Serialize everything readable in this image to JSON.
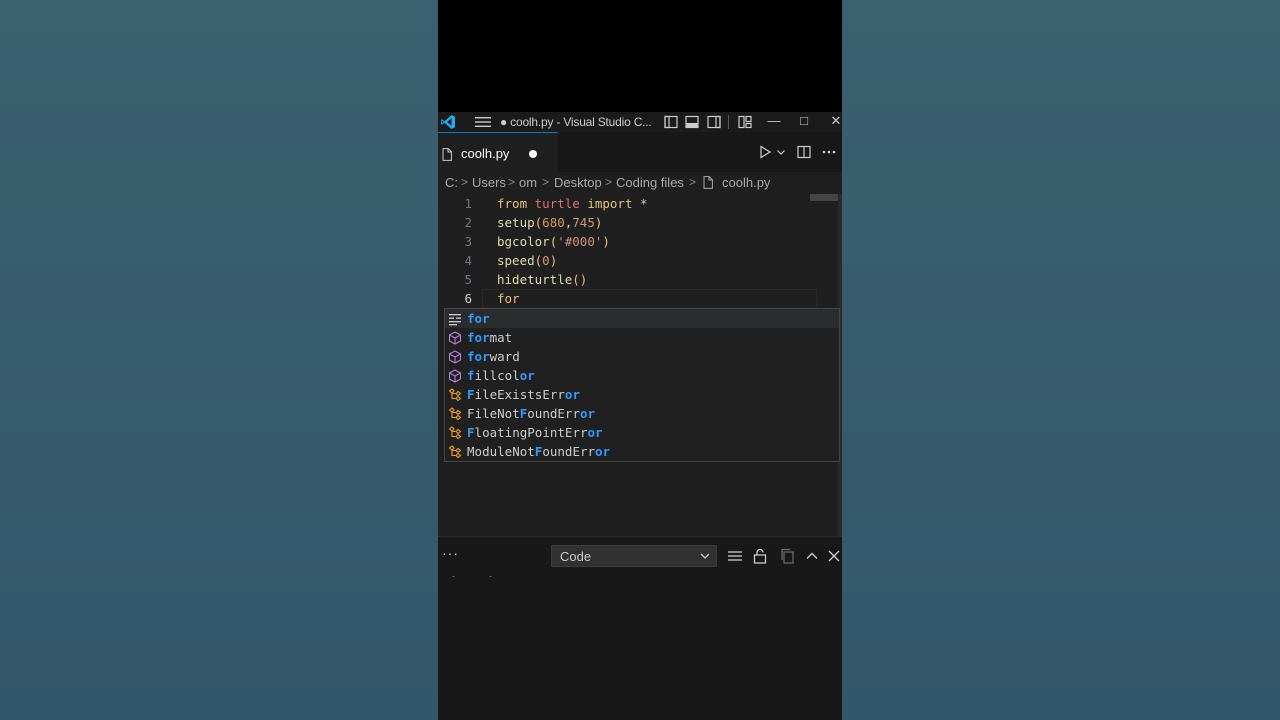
{
  "window": {
    "title": "● coolh.py - Visual Studio C..."
  },
  "window_controls": {
    "minimize": "—",
    "maximize": "□",
    "close": "✕"
  },
  "tab": {
    "label": "coolh.py",
    "dirty": true,
    "icons": [
      "file-icon",
      "run-icon",
      "split-editor-icon",
      "more-actions-icon"
    ]
  },
  "breadcrumb": {
    "items": [
      "C:",
      "Users",
      "om",
      "Desktop",
      "Coding files",
      "coolh.py"
    ],
    "separator": ">"
  },
  "editor": {
    "lines": [
      {
        "n": "1",
        "tokens": [
          {
            "t": "from",
            "c": "kw"
          },
          {
            "t": " ",
            "c": "plain"
          },
          {
            "t": "turtle",
            "c": "mod"
          },
          {
            "t": " ",
            "c": "plain"
          },
          {
            "t": "import",
            "c": "kw"
          },
          {
            "t": " *",
            "c": "plain"
          }
        ]
      },
      {
        "n": "2",
        "tokens": [
          {
            "t": "setup",
            "c": "fn"
          },
          {
            "t": "(",
            "c": "kw"
          },
          {
            "t": "680",
            "c": "num"
          },
          {
            "t": ",",
            "c": "plain"
          },
          {
            "t": "745",
            "c": "num"
          },
          {
            "t": ")",
            "c": "kw"
          }
        ]
      },
      {
        "n": "3",
        "tokens": [
          {
            "t": "bgcolor",
            "c": "fn"
          },
          {
            "t": "(",
            "c": "kw"
          },
          {
            "t": "'#000'",
            "c": "str"
          },
          {
            "t": ")",
            "c": "kw"
          }
        ]
      },
      {
        "n": "4",
        "tokens": [
          {
            "t": "speed",
            "c": "fn"
          },
          {
            "t": "(",
            "c": "kw"
          },
          {
            "t": "0",
            "c": "num"
          },
          {
            "t": ")",
            "c": "kw"
          }
        ]
      },
      {
        "n": "5",
        "tokens": [
          {
            "t": "hideturtle",
            "c": "fn"
          },
          {
            "t": "()",
            "c": "kw"
          }
        ]
      },
      {
        "n": "6",
        "tokens": [
          {
            "t": "for",
            "c": "kw"
          }
        ]
      }
    ],
    "active_line": "6"
  },
  "suggestions": [
    {
      "label": "for",
      "match": "for",
      "kind": "snippet",
      "icon": "snippet-icon",
      "selected": true
    },
    {
      "label": "format",
      "match": "for",
      "kind": "method",
      "icon": "method-icon"
    },
    {
      "label": "forward",
      "match": "for",
      "kind": "method",
      "icon": "method-icon"
    },
    {
      "label": "fillcolor",
      "match": "f,o,r",
      "kind": "method",
      "icon": "method-icon"
    },
    {
      "label": "FileExistsError",
      "match": "F,o,r",
      "kind": "class",
      "icon": "class-icon"
    },
    {
      "label": "FileNotFoundError",
      "match": "F,o,r",
      "kind": "class",
      "icon": "class-icon"
    },
    {
      "label": "FloatingPointError",
      "match": "F,o,r",
      "kind": "class",
      "icon": "class-icon"
    },
    {
      "label": "ModuleNotFoundError",
      "match": "F,o,r",
      "kind": "class",
      "icon": "class-icon"
    }
  ],
  "panel": {
    "dots": "···",
    "select_value": "Code",
    "icons": [
      "clear-output-icon",
      "lock-scroll-icon",
      "copy-icon",
      "maximize-panel-icon",
      "close-panel-icon"
    ],
    "marks": [
      "-",
      "-"
    ]
  },
  "colors": {
    "accent": "#0078d4",
    "match_highlight": "#2f9bff",
    "keyword": "#e5c07b",
    "function": "#dcdcaa",
    "module": "#e06c75",
    "number": "#d19a66",
    "string": "#ce9178",
    "class_icon": "#ee9d28",
    "method_icon": "#b180d7"
  }
}
